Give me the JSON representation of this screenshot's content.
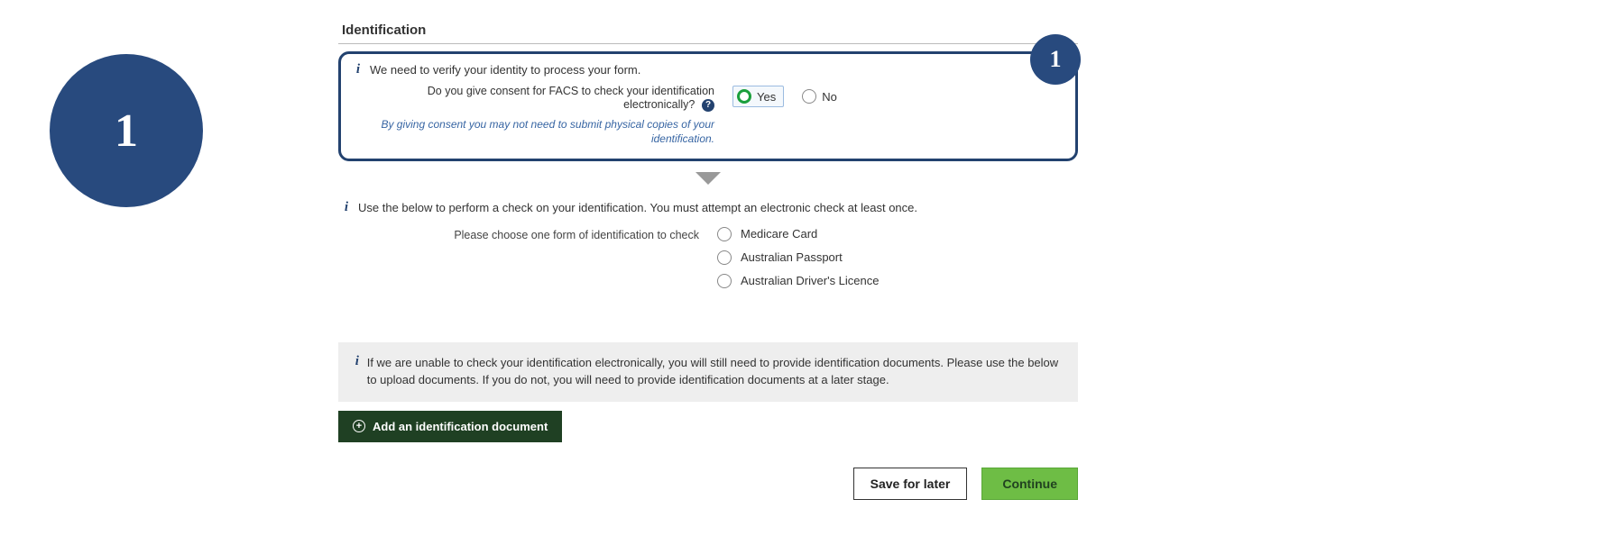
{
  "step": {
    "big": "1",
    "badge": "1"
  },
  "section_title": "Identification",
  "consent": {
    "heading": "We need to verify your identity to process your form.",
    "question": "Do you give consent for FACS to check your identification electronically?",
    "hint": "By giving consent you may not need to submit physical copies of your identification.",
    "yes": "Yes",
    "no": "No",
    "help": "?"
  },
  "check": {
    "heading": "Use the below to perform a check on your identification. You must attempt an electronic check at least once.",
    "choose_label": "Please choose one form of identification to check",
    "options": [
      "Medicare Card",
      "Australian Passport",
      "Australian Driver's Licence"
    ]
  },
  "notice": "If we are unable to check your identification electronically, you will still need to provide identification documents. Please use the below to upload documents. If you do not, you will need to provide identification documents at a later stage.",
  "add_doc_label": "Add an identification document",
  "actions": {
    "save": "Save for later",
    "continue": "Continue"
  }
}
